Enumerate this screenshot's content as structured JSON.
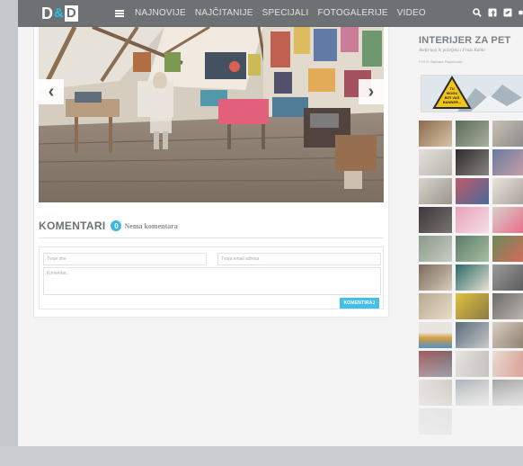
{
  "brand": {
    "logo_left": "D",
    "logo_amp": "&",
    "logo_right": "D"
  },
  "nav": {
    "items": [
      "NAJNOVIJE",
      "NAJČITANIJE",
      "SPECIJALI",
      "FOTOGALERIJE",
      "VIDEO"
    ],
    "icons": [
      "search-icon",
      "facebook-icon",
      "twitter-icon",
      "instagram-icon"
    ]
  },
  "article": {
    "slider_arrows": {
      "prev": "‹",
      "next": "›"
    }
  },
  "comments": {
    "title": "KOMENTARI",
    "count": "0",
    "status": "Nema komentara",
    "form": {
      "name_placeholder": "Tvoje ime",
      "email_placeholder": "Tvoja email adresa",
      "comment_placeholder": "Komentar...",
      "submit_label": "KOMENTIRAJ"
    }
  },
  "sidebar": {
    "title": "INTERIJER ZA PET",
    "subtitle": "Atelje koji bi poželjela i Frida Kahlo",
    "credit": "FOTO: Barbara Piskićnoski",
    "banner_text": "TU\nMOGU\nBITI VAŠ\nBANNER..."
  },
  "colors": {
    "navbar": "#6d7174",
    "accent": "#44c0e8",
    "background": "#f4f4f4"
  }
}
